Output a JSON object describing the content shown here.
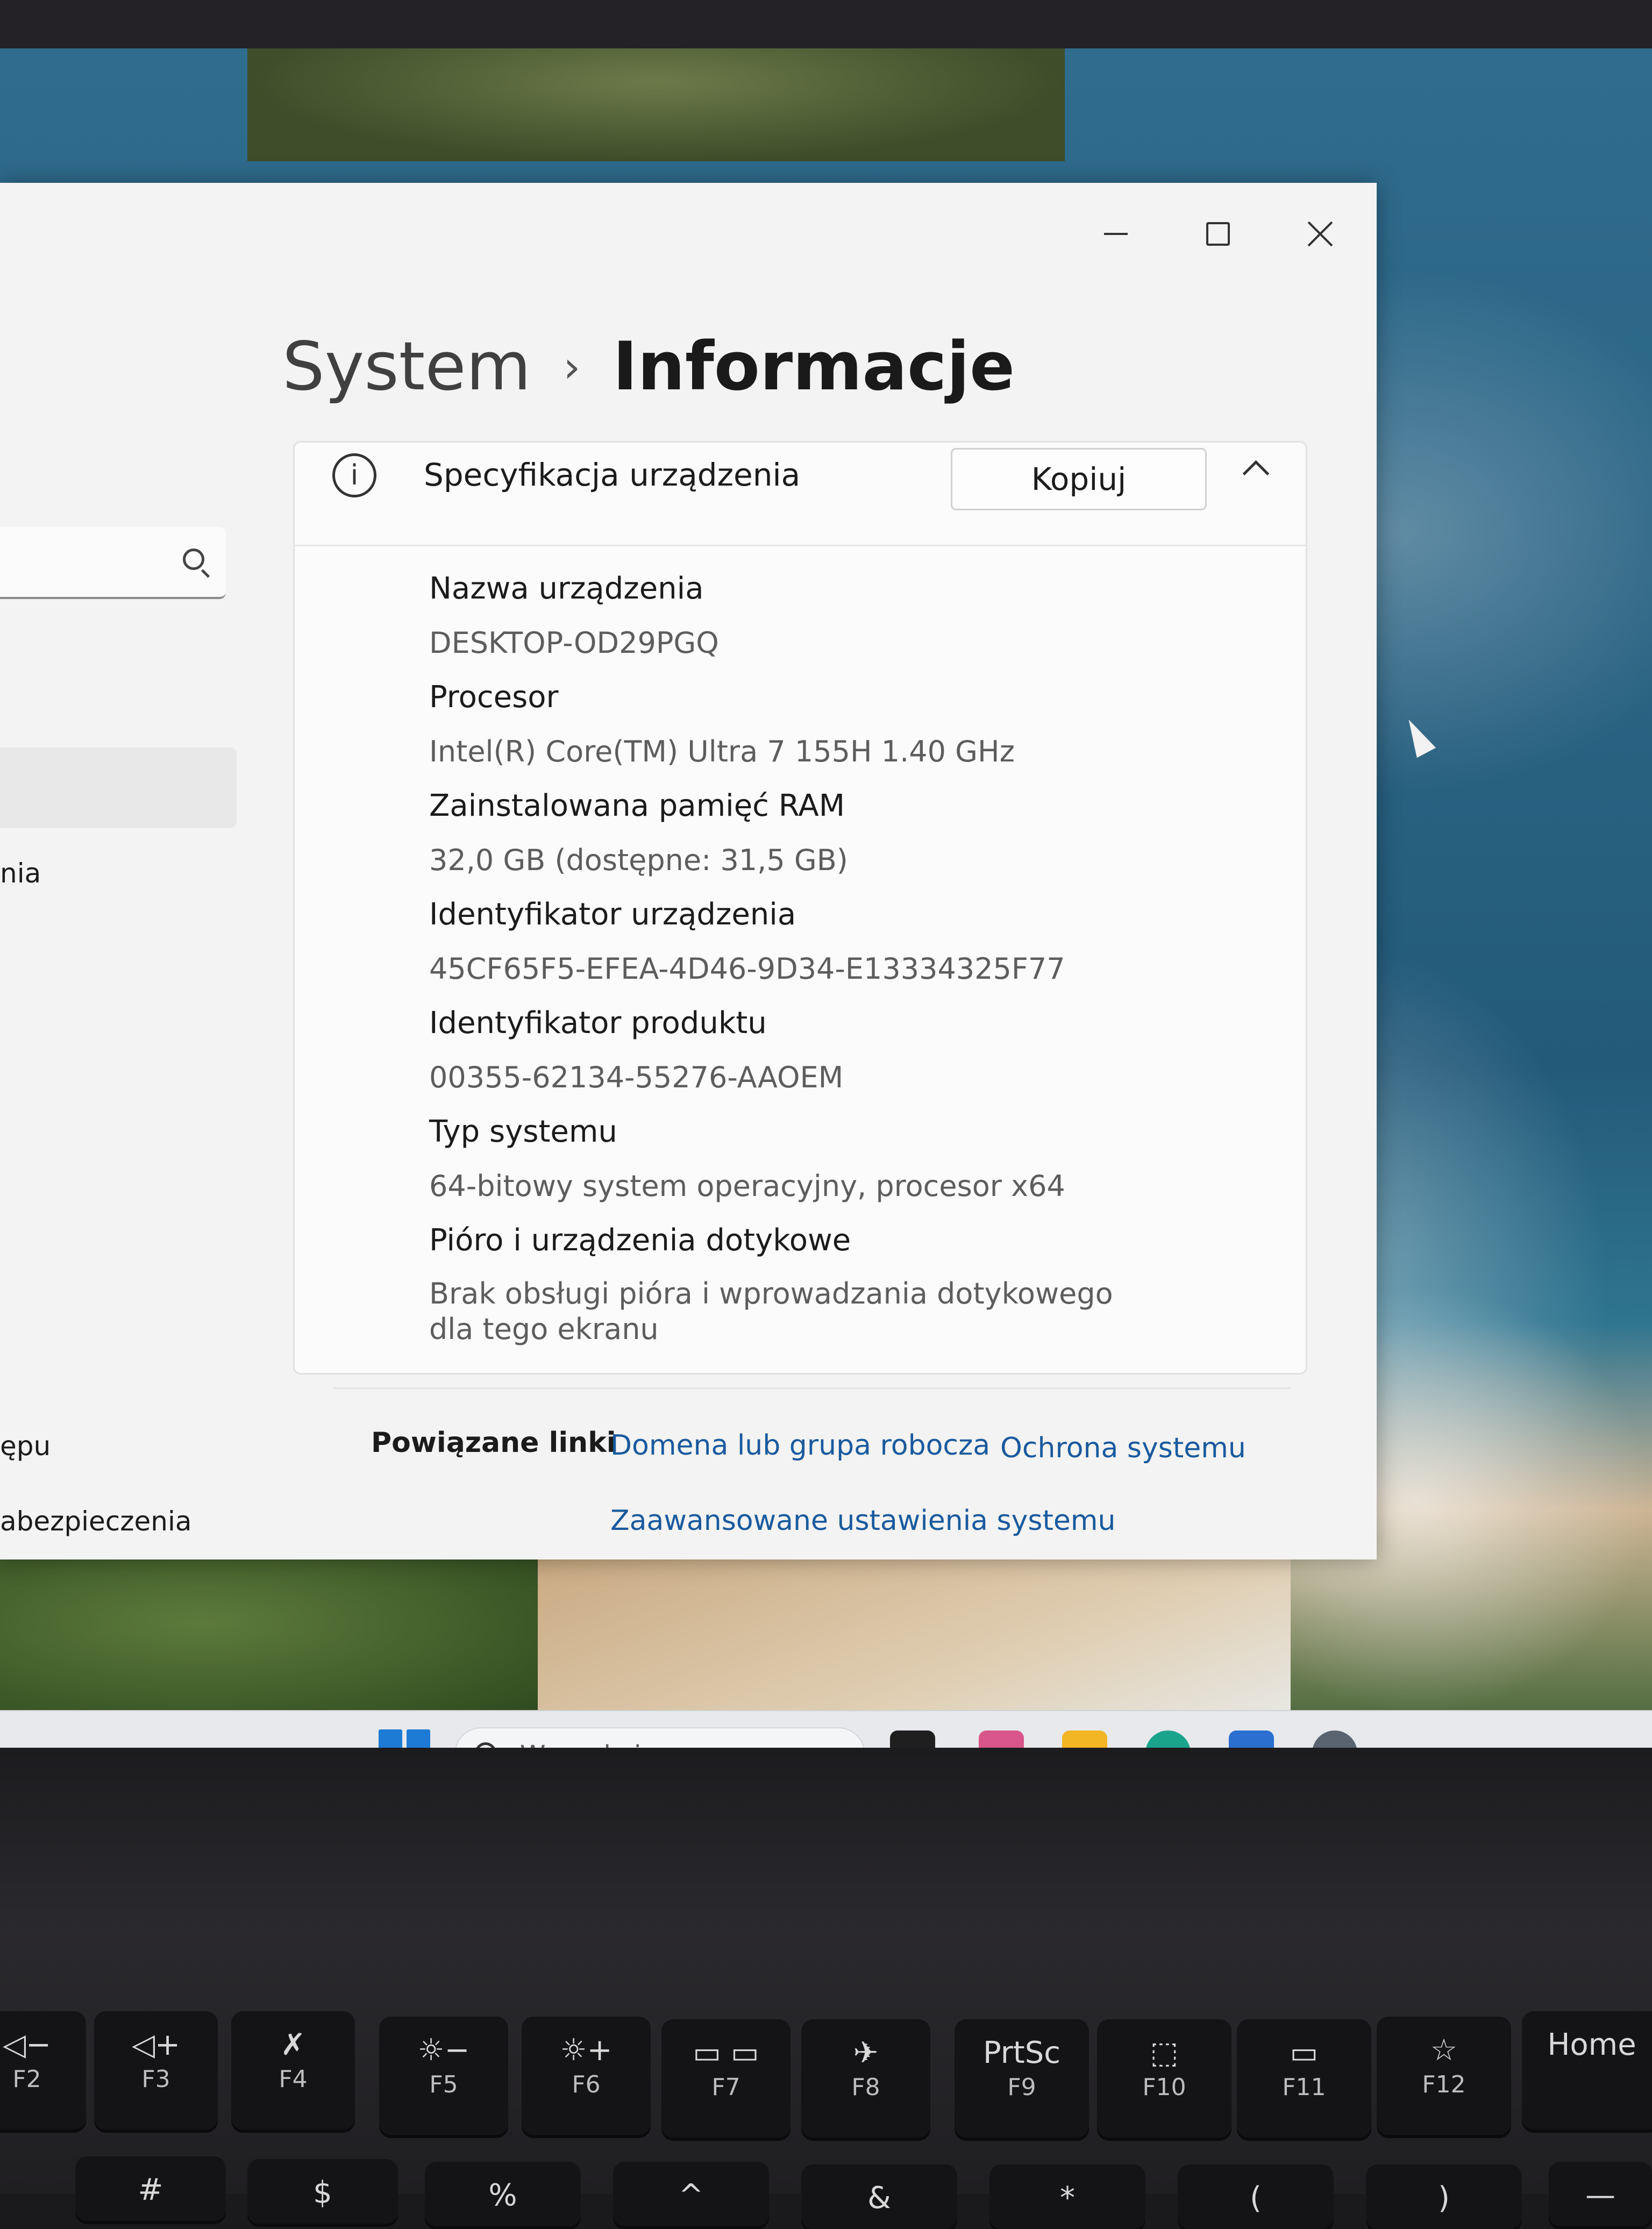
{
  "window": {
    "breadcrumb_parent": "System",
    "breadcrumb_separator": "›",
    "breadcrumb_current": "Informacje"
  },
  "sidebar": {
    "items": [
      {
        "label": "nia"
      },
      {
        "label": "ępu"
      },
      {
        "label": "abezpieczenia"
      }
    ]
  },
  "spec_card": {
    "title": "Specyfikacja urządzenia",
    "copy_label": "Kopiuj",
    "rows": [
      {
        "label": "Nazwa urządzenia",
        "value": "DESKTOP-OD29PGQ"
      },
      {
        "label": "Procesor",
        "value": "Intel(R) Core(TM) Ultra 7 155H   1.40 GHz"
      },
      {
        "label": "Zainstalowana pamięć RAM",
        "value": "32,0 GB (dostępne: 31,5 GB)"
      },
      {
        "label": "Identyfikator urządzenia",
        "value": "45CF65F5-EFEA-4D46-9D34-E13334325F77"
      },
      {
        "label": "Identyfikator produktu",
        "value": "00355-62134-55276-AAOEM"
      },
      {
        "label": "Typ systemu",
        "value": "64-bitowy system operacyjny, procesor x64"
      },
      {
        "label": "Pióro i urządzenia dotykowe",
        "value": "Brak obsługi pióra i wprowadzania dotykowego dla tego ekranu"
      }
    ]
  },
  "related_links": {
    "title": "Powiązane linki",
    "links": [
      {
        "label": "Domena lub grupa robocza"
      },
      {
        "label": "Ochrona systemu"
      },
      {
        "label": "Zaawansowane ustawienia systemu"
      }
    ]
  },
  "taskbar": {
    "search_placeholder": "Wyszukaj",
    "apps": [
      {
        "icon": "terminal-icon",
        "color": "#1f1f1f"
      },
      {
        "icon": "copilot-icon",
        "color": "#d9568a"
      },
      {
        "icon": "file-explorer-icon",
        "color": "#f2b524"
      },
      {
        "icon": "edge-icon",
        "color": "#1aa48c"
      },
      {
        "icon": "store-icon",
        "color": "#2b6fd0"
      },
      {
        "icon": "settings-gear-icon",
        "color": "#5a6470"
      }
    ]
  },
  "keyboard": {
    "fn_keys": [
      {
        "top": "◁−",
        "bottom": "F2"
      },
      {
        "top": "◁+",
        "bottom": "F3"
      },
      {
        "top": "✗",
        "bottom": "F4"
      },
      {
        "top": "☼−",
        "bottom": "F5"
      },
      {
        "top": "☼+",
        "bottom": "F6"
      },
      {
        "top": "▭ ▭",
        "bottom": "F7"
      },
      {
        "top": "✈",
        "bottom": "F8"
      },
      {
        "top": "PrtSc",
        "bottom": "F9"
      },
      {
        "top": "⬚",
        "bottom": "F10"
      },
      {
        "top": "▭",
        "bottom": "F11"
      },
      {
        "top": "☆",
        "bottom": "F12"
      },
      {
        "top": "Home",
        "bottom": ""
      }
    ],
    "num_row": [
      "#",
      "$",
      "%",
      "^",
      "&",
      "*",
      "(",
      ")",
      "—"
    ]
  }
}
